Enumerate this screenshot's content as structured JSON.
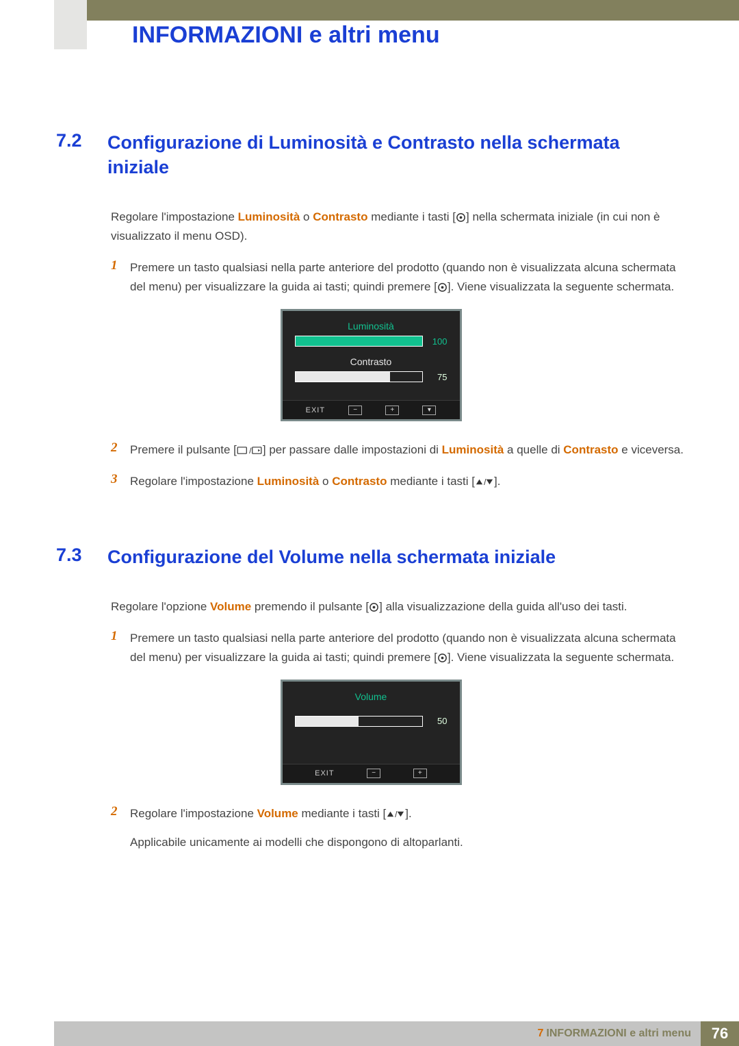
{
  "chapter_title": "INFORMAZIONI e altri menu",
  "section72": {
    "number": "7.2",
    "title": "Configurazione di Luminosità e Contrasto nella schermata iniziale",
    "intro_pre": "Regolare l'impostazione ",
    "intro_lum": "Luminosità",
    "intro_or": " o ",
    "intro_con": "Contrasto",
    "intro_mid": " mediante i tasti [",
    "intro_post": "] nella schermata iniziale (in cui non è visualizzato il menu OSD).",
    "step1_a": "Premere un tasto qualsiasi nella parte anteriore del prodotto (quando non è visualizzata alcuna schermata del menu) per visualizzare la guida ai tasti; quindi premere [",
    "step1_b": "]. Viene visualizzata la seguente schermata.",
    "osd1": {
      "brightness_label": "Luminosità",
      "brightness_value": "100",
      "contrast_label": "Contrasto",
      "contrast_value": "75",
      "exit": "EXIT"
    },
    "step2_a": "Premere il pulsante [",
    "step2_b": "] per passare dalle impostazioni di ",
    "step2_lum": "Luminosità",
    "step2_c": " a quelle di ",
    "step2_con": "Contrasto",
    "step2_d": " e viceversa.",
    "step3_a": "Regolare l'impostazione ",
    "step3_lum": "Luminosità",
    "step3_or": " o ",
    "step3_con": "Contrasto",
    "step3_b": " mediante i tasti [",
    "step3_c": "].",
    "n1": "1",
    "n2": "2",
    "n3": "3"
  },
  "section73": {
    "number": "7.3",
    "title": "Configurazione del Volume nella schermata iniziale",
    "intro_a": "Regolare l'opzione ",
    "intro_vol": "Volume",
    "intro_b": " premendo il pulsante [",
    "intro_c": "] alla visualizzazione della guida all'uso dei tasti.",
    "step1_a": "Premere un tasto qualsiasi nella parte anteriore del prodotto (quando non è visualizzata alcuna schermata del menu) per visualizzare la guida ai tasti; quindi premere [",
    "step1_b": "]. Viene visualizzata la seguente schermata.",
    "osd2": {
      "volume_label": "Volume",
      "volume_value": "50",
      "exit": "EXIT"
    },
    "step2_a": "Regolare l'impostazione ",
    "step2_vol": "Volume",
    "step2_b": " mediante i tasti [",
    "step2_c": "].",
    "note": "Applicabile unicamente ai modelli che dispongono di altoparlanti.",
    "n1": "1",
    "n2": "2"
  },
  "footer": {
    "chap_num": "7",
    "chap_text": " INFORMAZIONI e altri menu",
    "page_num": "76"
  },
  "icons": {
    "minus": "−",
    "plus": "+",
    "down": "▾"
  }
}
